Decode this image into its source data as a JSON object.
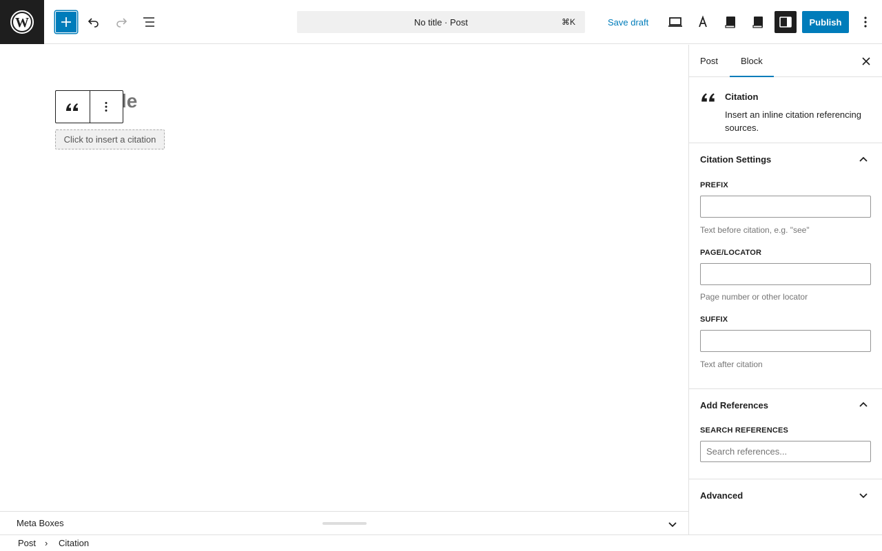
{
  "topbar": {
    "document_title": "No title · Post",
    "shortcut": "⌘K",
    "save_draft_label": "Save draft",
    "publish_label": "Publish",
    "accent_color": "#007cba"
  },
  "canvas": {
    "title_visible_fragment": "le",
    "citation_placeholder": "Click to insert a citation"
  },
  "meta_boxes": {
    "label": "Meta Boxes"
  },
  "breadcrumb": {
    "items": [
      "Post",
      "Citation"
    ],
    "separator": "›"
  },
  "sidebar": {
    "tabs": [
      {
        "label": "Post",
        "active": false
      },
      {
        "label": "Block",
        "active": true
      }
    ],
    "block_card": {
      "name": "Citation",
      "description": "Insert an inline citation referencing sources."
    },
    "citation_settings": {
      "title": "Citation Settings",
      "prefix_label": "PREFIX",
      "prefix_value": "",
      "prefix_help": "Text before citation, e.g. \"see\"",
      "locator_label": "PAGE/LOCATOR",
      "locator_value": "",
      "locator_help": "Page number or other locator",
      "suffix_label": "SUFFIX",
      "suffix_value": "",
      "suffix_help": "Text after citation"
    },
    "add_references": {
      "title": "Add References",
      "search_label": "SEARCH REFERENCES",
      "search_placeholder": "Search references..."
    },
    "advanced": {
      "title": "Advanced"
    }
  }
}
